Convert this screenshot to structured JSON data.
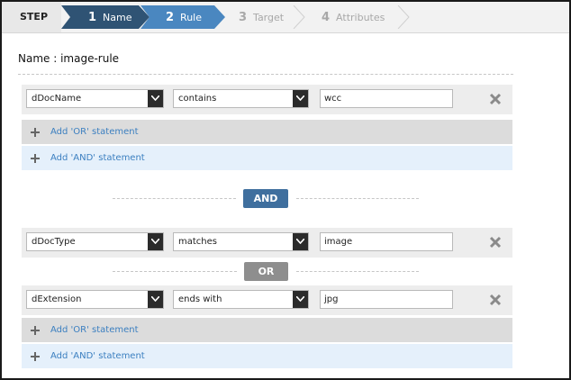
{
  "wizard": {
    "step_label": "STEP",
    "steps": [
      {
        "num": "1",
        "label": "Name",
        "state": "done",
        "color": "#2f5374"
      },
      {
        "num": "2",
        "label": "Rule",
        "state": "current",
        "color": "#4a87c0"
      },
      {
        "num": "3",
        "label": "Target",
        "state": "todo",
        "color": "#f2f2f2"
      },
      {
        "num": "4",
        "label": "Attributes",
        "state": "todo",
        "color": "#f2f2f2"
      }
    ]
  },
  "rule": {
    "name_label": "Name :",
    "name_value": "image-rule"
  },
  "group1": {
    "conditions": [
      {
        "field": "dDocName",
        "operator": "contains",
        "value": "wcc"
      }
    ],
    "add_or_label": "Add 'OR' statement",
    "add_and_label": "Add 'AND' statement"
  },
  "connector_and": "AND",
  "group2": {
    "conditions": [
      {
        "field": "dDocType",
        "operator": "matches",
        "value": "image"
      },
      {
        "field": "dExtension",
        "operator": "ends with",
        "value": "jpg"
      }
    ],
    "connector_or": "OR",
    "add_or_label": "Add 'OR' statement",
    "add_and_label": "Add 'AND' statement"
  },
  "icons": {
    "delete": "close-icon",
    "add": "plus-icon",
    "dropdown": "chevron-down-icon"
  }
}
